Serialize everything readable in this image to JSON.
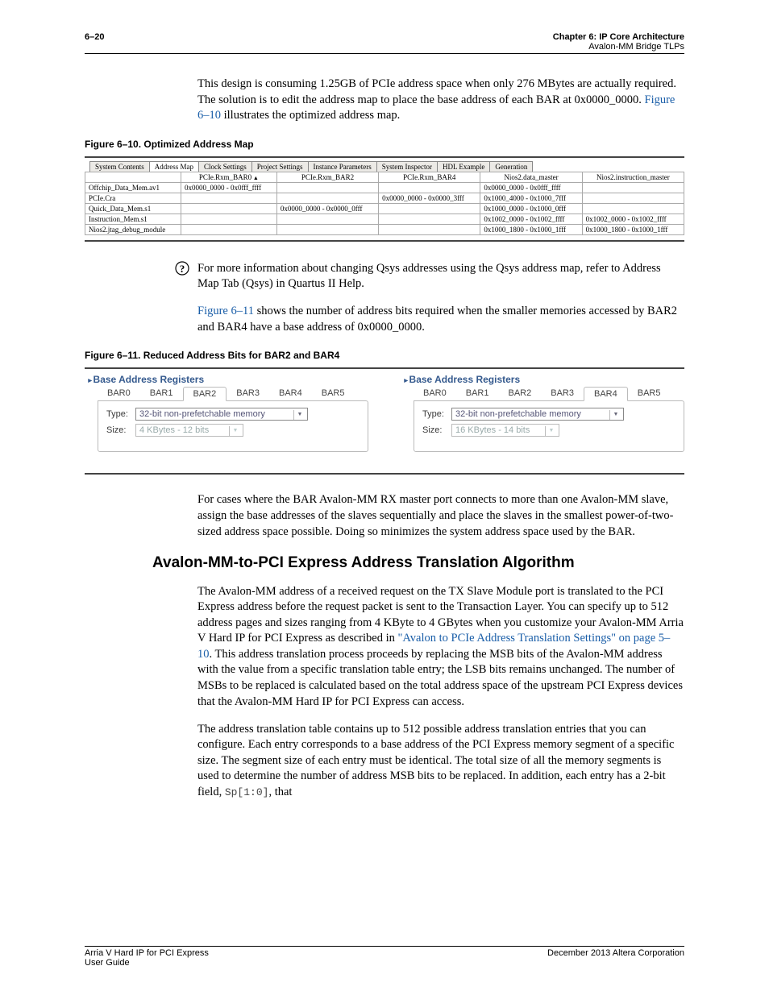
{
  "header": {
    "page_num": "6–20",
    "chapter": "Chapter 6: IP Core Architecture",
    "section": "Avalon-MM Bridge TLPs"
  },
  "intro_para": {
    "pre": "This design is consuming 1.25GB of PCIe address space when only 276 MBytes are actually required. The solution is to edit the address map to place the base address of each BAR at 0x0000_0000. ",
    "link": "Figure 6–10",
    "post": " illustrates the optimized address map."
  },
  "fig610_caption": "Figure 6–10. Optimized Address Map",
  "addr_map": {
    "tabs": [
      "System Contents",
      "Address Map",
      "Clock Settings",
      "Project Settings",
      "Instance Parameters",
      "System Inspector",
      "HDL Example",
      "Generation"
    ],
    "active_tab": 1,
    "columns": [
      "",
      "PCIe.Rxm_BAR0",
      "PCIe.Rxm_BAR2",
      "PCIe.Rxm_BAR4",
      "Nios2.data_master",
      "Nios2.instruction_master"
    ],
    "rows": [
      {
        "label": "Offchip_Data_Mem.av1",
        "cells": [
          "0x0000_0000 - 0x0fff_ffff",
          "",
          "",
          "0x0000_0000 - 0x0fff_ffff",
          ""
        ]
      },
      {
        "label": "PCIe.Cra",
        "cells": [
          "",
          "",
          "0x0000_0000 - 0x0000_3fff",
          "0x1000_4000 - 0x1000_7fff",
          ""
        ]
      },
      {
        "label": "Quick_Data_Mem.s1",
        "cells": [
          "",
          "0x0000_0000 - 0x0000_0fff",
          "",
          "0x1000_0000 - 0x1000_0fff",
          ""
        ]
      },
      {
        "label": "Instruction_Mem.s1",
        "cells": [
          "",
          "",
          "",
          "0x1002_0000 - 0x1002_ffff",
          "0x1002_0000 - 0x1002_ffff"
        ]
      },
      {
        "label": "Nios2.jtag_debug_module",
        "cells": [
          "",
          "",
          "",
          "0x1000_1800 - 0x1000_1fff",
          "0x1000_1800 - 0x1000_1fff"
        ]
      }
    ]
  },
  "info1": {
    "pre": "For more information about changing Qsys addresses using the Qsys address map, refer to ",
    "link": "Address Map Tab (Qsys)",
    "post": " in Quartus II Help."
  },
  "para2": {
    "link": "Figure 6–11",
    "post": " shows the number of address bits required when the smaller memories accessed by BAR2 and BAR4 have a base address of 0x0000_0000."
  },
  "fig611_caption": "Figure 6–11. Reduced Address Bits for BAR2 and BAR4",
  "bar_panels": {
    "title": "Base Address Registers",
    "tabs": [
      "BAR0",
      "BAR1",
      "BAR2",
      "BAR3",
      "BAR4",
      "BAR5"
    ],
    "type_label": "Type:",
    "size_label": "Size:",
    "type_value": "32-bit non-prefetchable memory",
    "left": {
      "active": 2,
      "size": "4 KBytes - 12 bits"
    },
    "right": {
      "active": 4,
      "size": "16 KBytes - 14 bits"
    }
  },
  "para3": "For cases where the BAR Avalon-MM RX master port connects to more than one Avalon-MM slave, assign the base addresses of the slaves sequentially and place the slaves in the smallest power-of-two-sized address space possible. Doing so minimizes the system address space used by the BAR.",
  "section_title": "Avalon-MM-to-PCI Express Address Translation Algorithm",
  "para4": {
    "pre": "The Avalon-MM address of a received request on the TX Slave Module port is translated to the PCI Express address before the request packet is sent to the Transaction Layer. You can specify up to 512 address pages and sizes ranging from 4 KByte to 4 GBytes when you customize your Avalon-MM Arria  V Hard IP for PCI Express as described in ",
    "link": "\"Avalon to PCIe Address Translation Settings\" on page 5–10",
    "post": ". This address translation process proceeds by replacing the MSB bits of the Avalon-MM address with the value from a specific translation table entry; the LSB bits remains unchanged. The number of MSBs to be replaced is calculated based on the total address space of the upstream PCI Express devices that the Avalon-MM Hard IP for PCI Express can access."
  },
  "para5_pre": "The address translation table contains up to 512 possible address translation entries that you can configure. Each entry corresponds to a base address of the PCI Express memory segment of a specific size. The segment size of each entry must be identical. The total size of all the memory segments is used to determine the number of address MSB bits to be replaced. In addition, each entry has a 2-bit field, ",
  "para5_field": "Sp[1:0]",
  "para5_post": ", that",
  "footer": {
    "left1": "Arria V Hard IP for PCI Express",
    "left2": "User Guide",
    "right": "December 2013   Altera Corporation"
  }
}
